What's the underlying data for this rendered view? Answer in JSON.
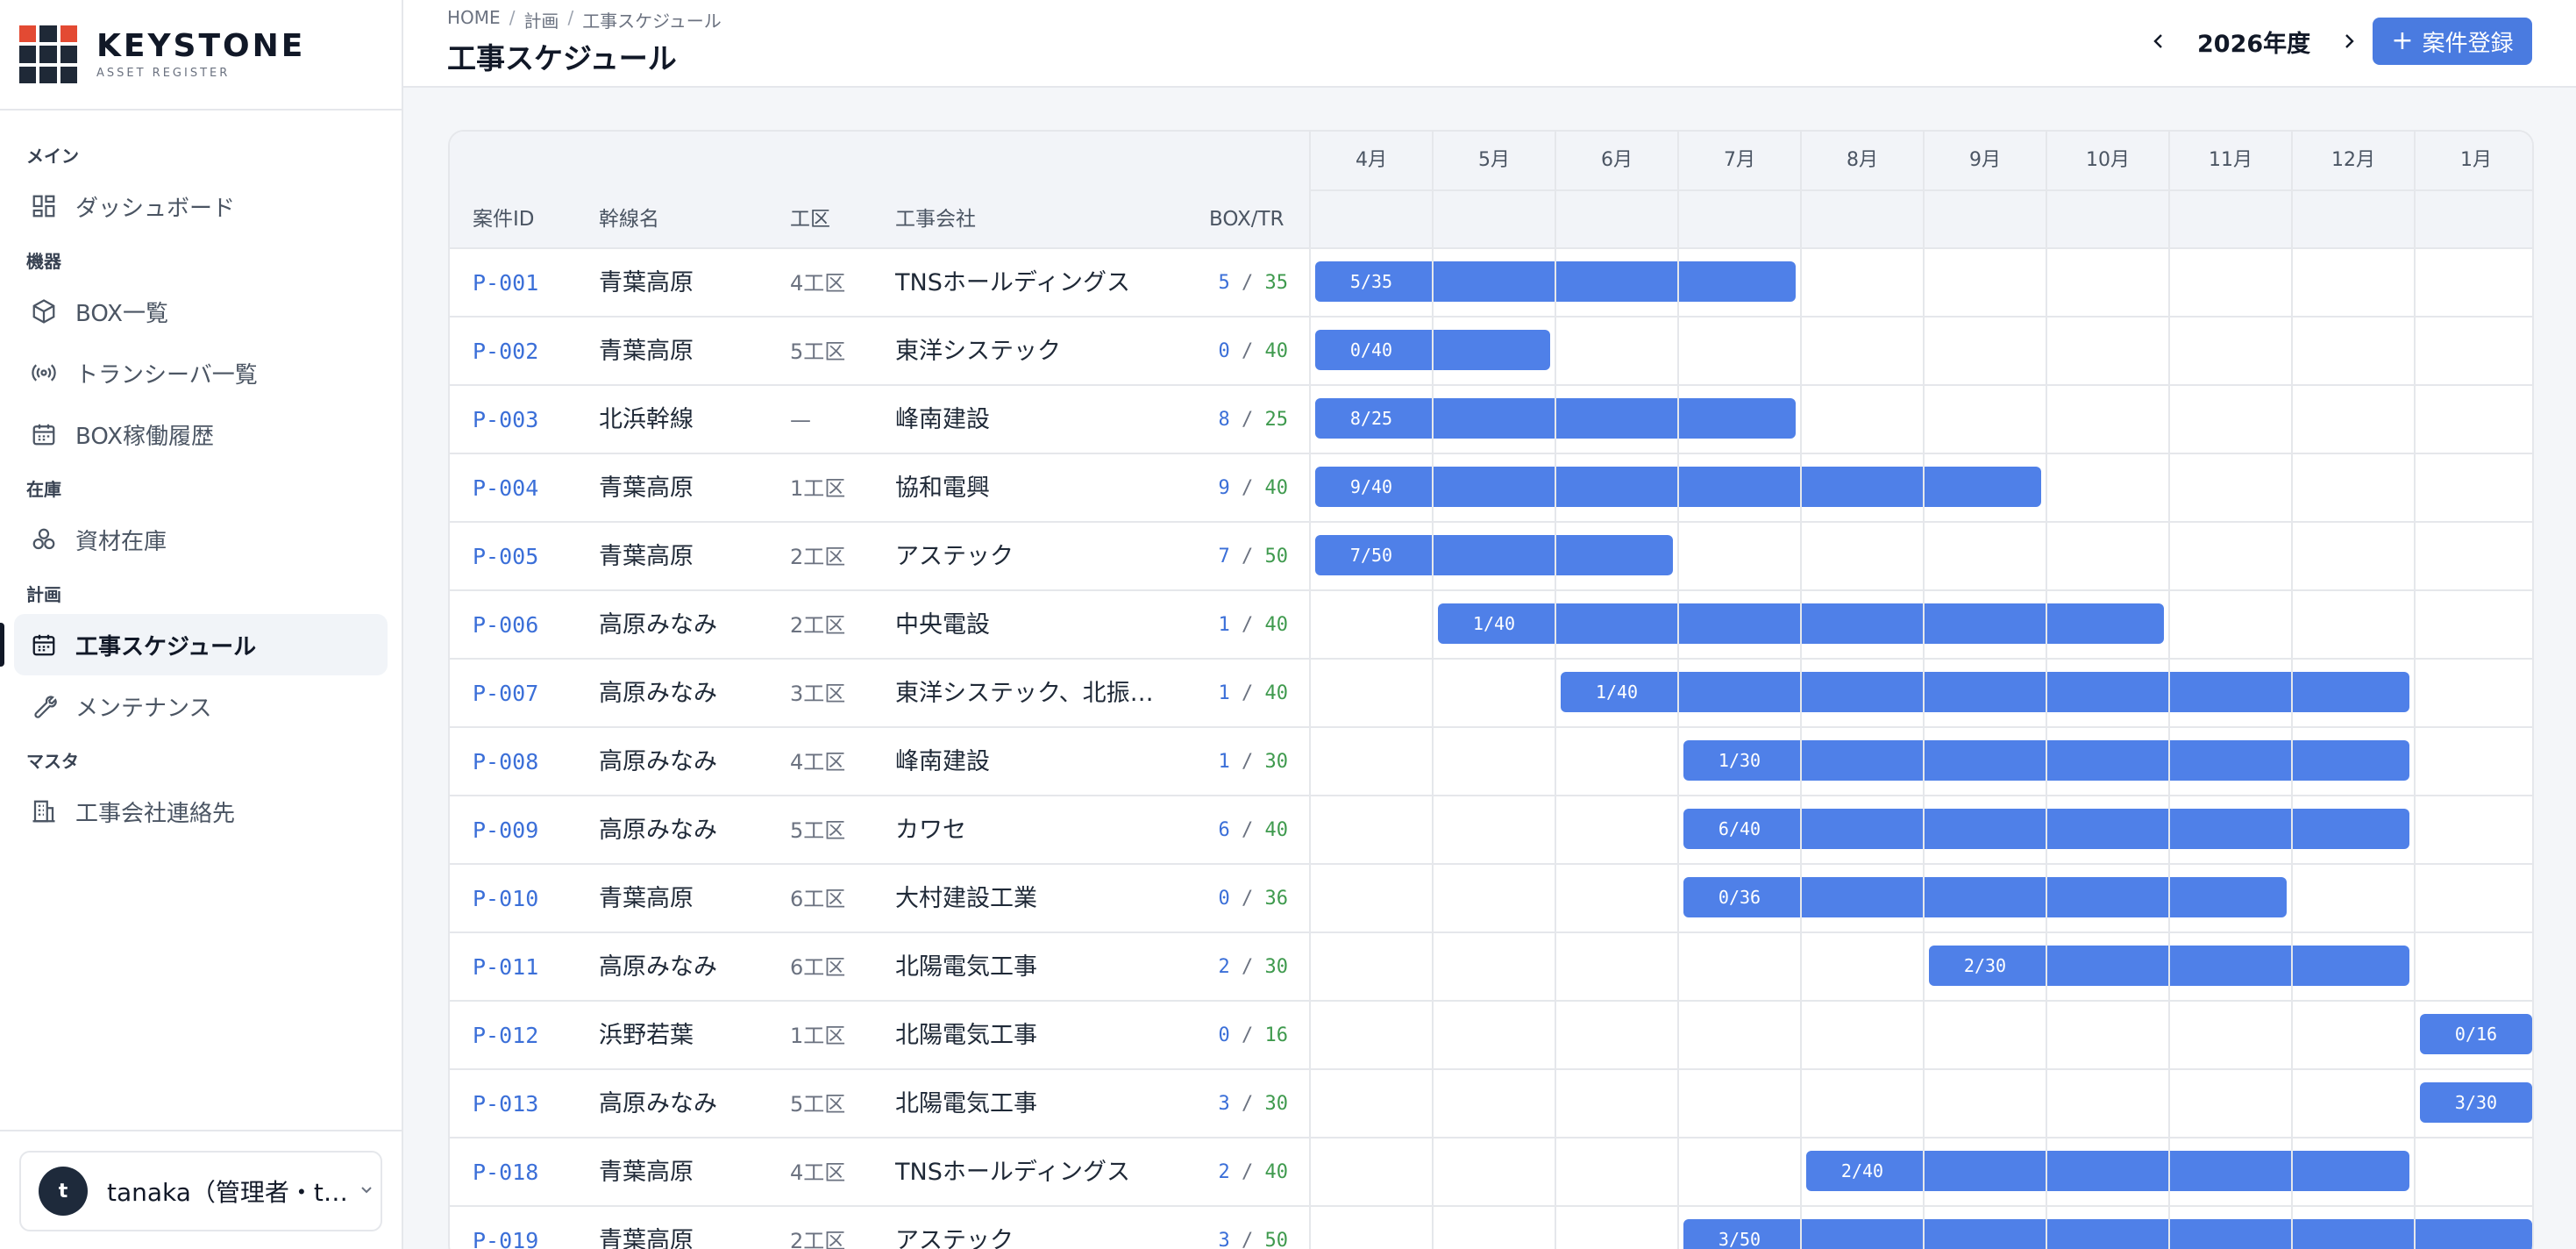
{
  "brand": {
    "name": "KEYSTONE",
    "sub": "ASSET REGISTER"
  },
  "nav": {
    "sections": [
      {
        "label": "メイン",
        "items": [
          {
            "label": "ダッシュボード",
            "icon": "dashboard-icon"
          }
        ]
      },
      {
        "label": "機器",
        "items": [
          {
            "label": "BOX一覧",
            "icon": "box-icon"
          },
          {
            "label": "トランシーバ一覧",
            "icon": "radio-icon"
          },
          {
            "label": "BOX稼働履歴",
            "icon": "calendar-icon"
          }
        ]
      },
      {
        "label": "在庫",
        "items": [
          {
            "label": "資材在庫",
            "icon": "materials-icon"
          }
        ]
      },
      {
        "label": "計画",
        "items": [
          {
            "label": "工事スケジュール",
            "icon": "calendar-icon",
            "active": true
          },
          {
            "label": "メンテナンス",
            "icon": "wrench-icon"
          }
        ]
      },
      {
        "label": "マスタ",
        "items": [
          {
            "label": "工事会社連絡先",
            "icon": "building-icon"
          }
        ]
      }
    ]
  },
  "user": {
    "initial": "t",
    "name": "tanaka（管理者・tanaka@example.jp）"
  },
  "header": {
    "breadcrumb": [
      "HOME",
      "計画",
      "工事スケジュール"
    ],
    "title": "工事スケジュール",
    "year": "2026年度",
    "add_label": "案件登録"
  },
  "table": {
    "columns": {
      "id": "案件ID",
      "line": "幹線名",
      "zone": "工区",
      "company": "工事会社",
      "boxtr": "BOX/TR"
    },
    "months": [
      "4月",
      "5月",
      "6月",
      "7月",
      "8月",
      "9月",
      "10月",
      "11月",
      "12月",
      "1月"
    ],
    "rows": [
      {
        "id": "P-001",
        "line": "青葉高原",
        "zone": "4工区",
        "company": "TNSホールディングス",
        "box": 5,
        "tr": 35,
        "label": "5/35",
        "start": 0,
        "end": 4
      },
      {
        "id": "P-002",
        "line": "青葉高原",
        "zone": "5工区",
        "company": "東洋システック",
        "box": 0,
        "tr": 40,
        "label": "0/40",
        "start": 0,
        "end": 2
      },
      {
        "id": "P-003",
        "line": "北浜幹線",
        "zone": "—",
        "company": "峰南建設",
        "box": 8,
        "tr": 25,
        "label": "8/25",
        "start": 0,
        "end": 4
      },
      {
        "id": "P-004",
        "line": "青葉高原",
        "zone": "1工区",
        "company": "協和電興",
        "box": 9,
        "tr": 40,
        "label": "9/40",
        "start": 0,
        "end": 6
      },
      {
        "id": "P-005",
        "line": "青葉高原",
        "zone": "2工区",
        "company": "アステック",
        "box": 7,
        "tr": 50,
        "label": "7/50",
        "start": 0,
        "end": 3
      },
      {
        "id": "P-006",
        "line": "高原みなみ",
        "zone": "2工区",
        "company": "中央電設",
        "box": 1,
        "tr": 40,
        "label": "1/40",
        "start": 1,
        "end": 7
      },
      {
        "id": "P-007",
        "line": "高原みなみ",
        "zone": "3工区",
        "company": "東洋システック、北振電気",
        "box": 1,
        "tr": 40,
        "label": "1/40",
        "start": 2,
        "end": 9
      },
      {
        "id": "P-008",
        "line": "高原みなみ",
        "zone": "4工区",
        "company": "峰南建設",
        "box": 1,
        "tr": 30,
        "label": "1/30",
        "start": 3,
        "end": 9
      },
      {
        "id": "P-009",
        "line": "高原みなみ",
        "zone": "5工区",
        "company": "カワセ",
        "box": 6,
        "tr": 40,
        "label": "6/40",
        "start": 3,
        "end": 9
      },
      {
        "id": "P-010",
        "line": "青葉高原",
        "zone": "6工区",
        "company": "大村建設工業",
        "box": 0,
        "tr": 36,
        "label": "0/36",
        "start": 3,
        "end": 8
      },
      {
        "id": "P-011",
        "line": "高原みなみ",
        "zone": "6工区",
        "company": "北陽電気工事",
        "box": 2,
        "tr": 30,
        "label": "2/30",
        "start": 5,
        "end": 9
      },
      {
        "id": "P-012",
        "line": "浜野若葉",
        "zone": "1工区",
        "company": "北陽電気工事",
        "box": 0,
        "tr": 16,
        "label": "0/16",
        "start": 9,
        "end": 10
      },
      {
        "id": "P-013",
        "line": "高原みなみ",
        "zone": "5工区",
        "company": "北陽電気工事",
        "box": 3,
        "tr": 30,
        "label": "3/30",
        "start": 9,
        "end": 10
      },
      {
        "id": "P-018",
        "line": "青葉高原",
        "zone": "4工区",
        "company": "TNSホールディングス",
        "box": 2,
        "tr": 40,
        "label": "2/40",
        "start": 4,
        "end": 9
      },
      {
        "id": "P-019",
        "line": "青葉高原",
        "zone": "2工区",
        "company": "アステック",
        "box": 3,
        "tr": 50,
        "label": "3/50",
        "start": 3,
        "end": 10
      }
    ]
  },
  "colors": {
    "accent": "#4a7be0",
    "bar": "#4f80e8",
    "id": "#3b6fd8",
    "tr": "#3f9a4e"
  }
}
